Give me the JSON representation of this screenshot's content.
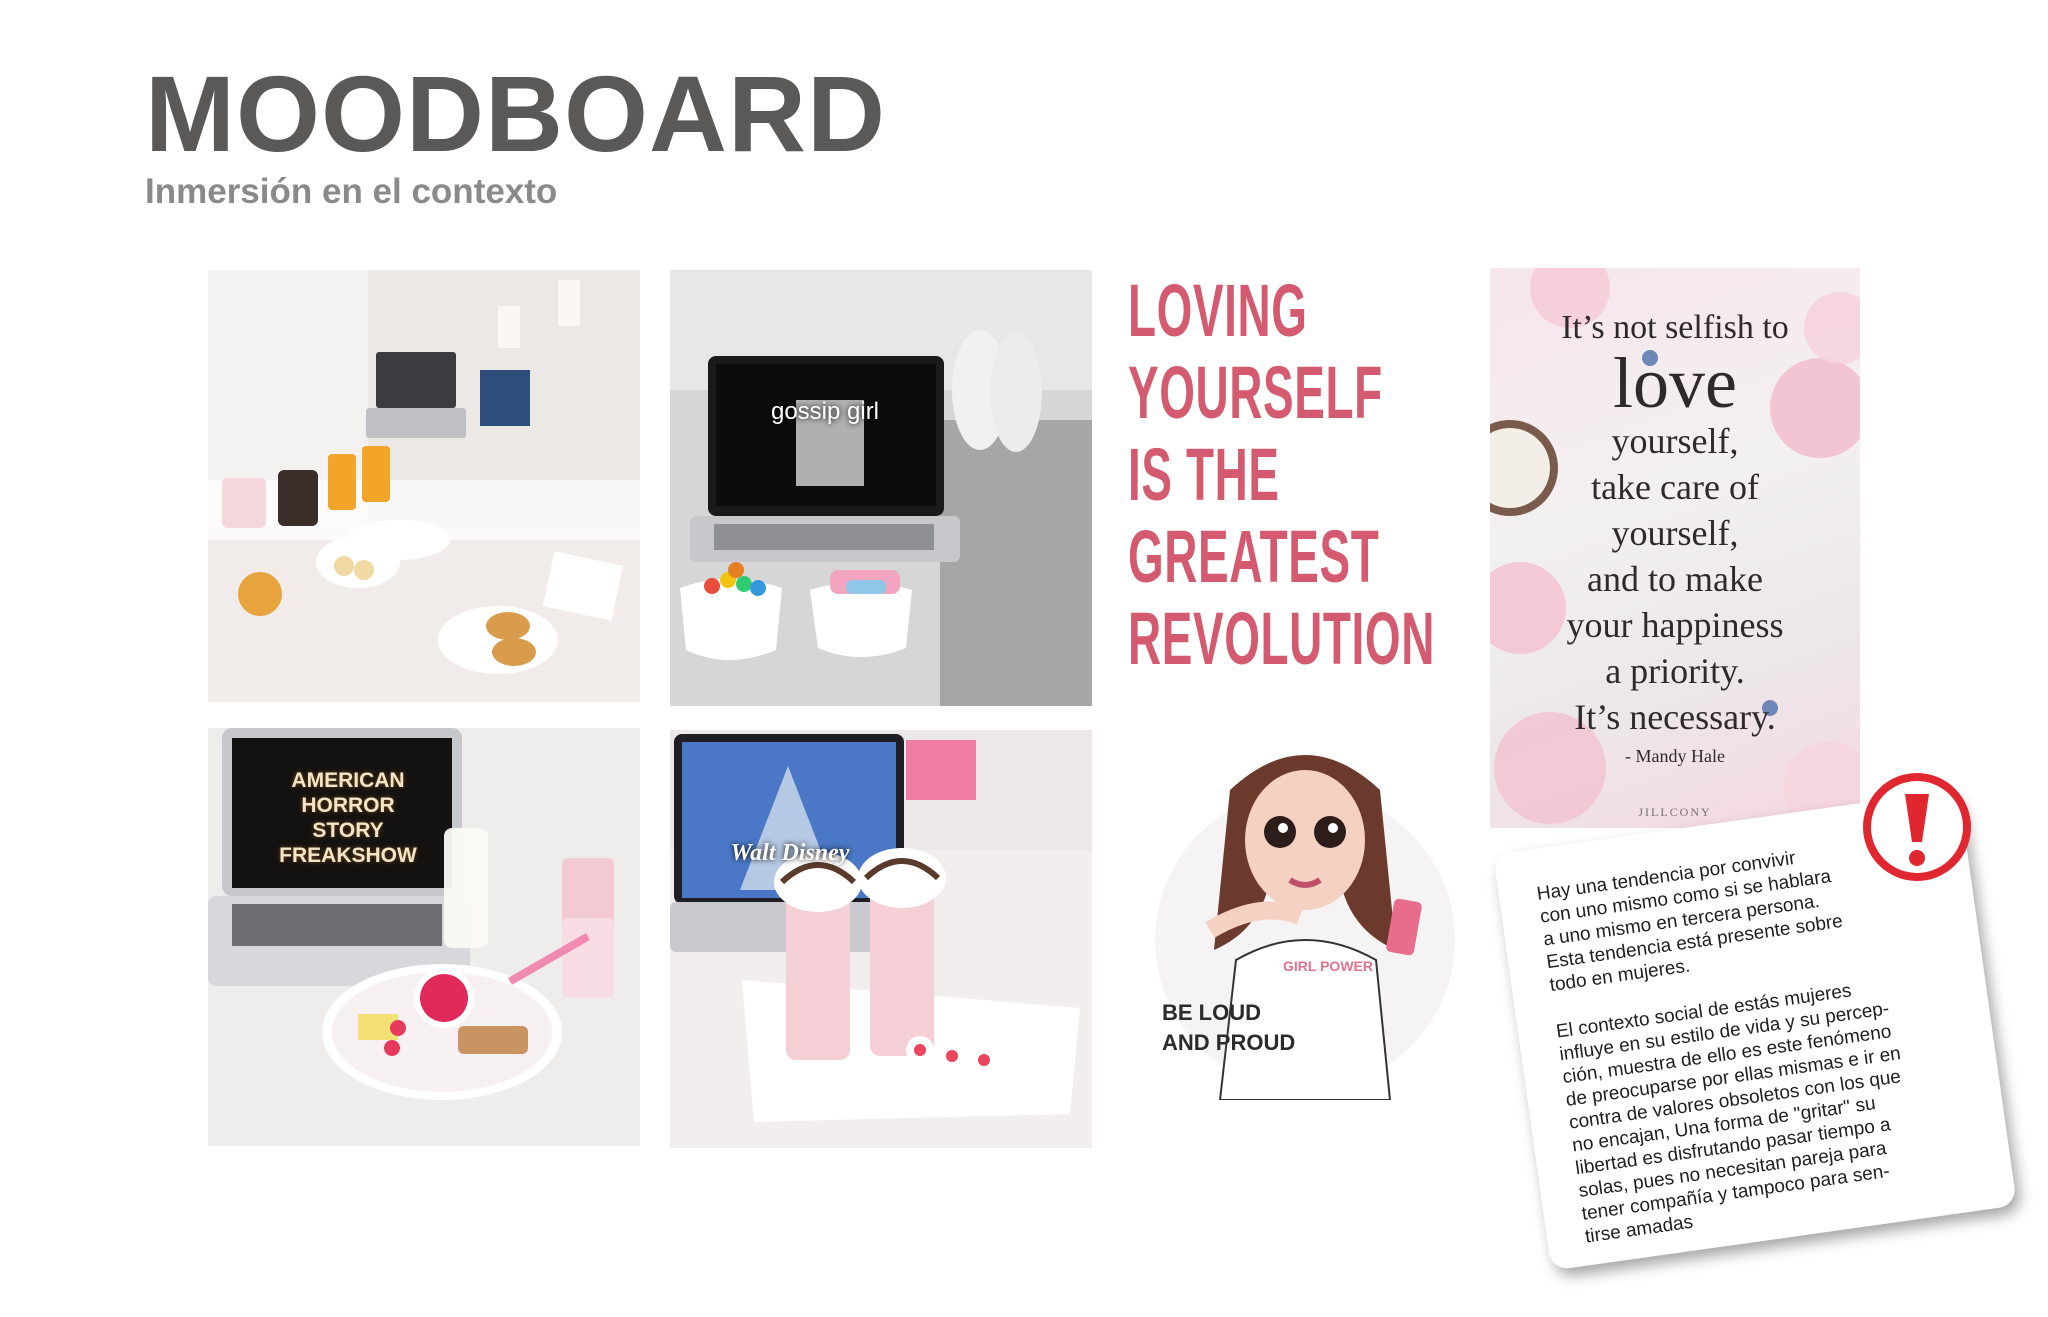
{
  "header": {
    "title": "MOODBOARD",
    "subtitle": "Inmersión en el contexto"
  },
  "photos": [
    {
      "name": "breakfast-in-bed-photo",
      "caption": ""
    },
    {
      "name": "gossip-girl-laptop-photo",
      "caption": "gossip girl"
    },
    {
      "name": "american-horror-story-laptop-photo",
      "caption": "AMERICAN HORROR STORY FREAKSHOW"
    },
    {
      "name": "walt-disney-laptop-photo",
      "caption": "Walt Disney"
    }
  ],
  "poster": {
    "lines": [
      "LOVING",
      "YOURSELF",
      "IS THE",
      "GREATEST",
      "REVOLUTION"
    ],
    "color": "#d45b6f"
  },
  "quote_card": {
    "line1": "It’s not selfish to",
    "line2": "love",
    "lines": [
      "yourself,",
      "take care of",
      "yourself,",
      "and to make",
      "your happiness",
      "a priority.",
      "It’s necessary."
    ],
    "author": "- Mandy Hale",
    "brand": "JILLCONY"
  },
  "illustration": {
    "slogan_line1": "BE LOUD",
    "slogan_line2": "AND PROUD",
    "shirt_text": "GIRL POWER"
  },
  "note": {
    "paragraph1": "Hay una tendencia por convivir\ncon uno mismo como si se hablara\na uno mismo en tercera persona.\nEsta tendencia está presente sobre\ntodo en mujeres.",
    "paragraph2": "El contexto social de estás mujeres\ninfluye en su estilo de vida y su percep-\nción, muestra de ello es este fenómeno\nde preocuparse por ellas mismas e ir en\ncontra de valores obsoletos con los que\nno encajan, Una forma de \"gritar\" su\nlibertad es disfrutando pasar tiempo a\nsolas, pues no necesitan pareja para\ntener compañía y tampoco para sen-\ntirse amadas",
    "alert_icon": "exclamation-icon",
    "alert_color": "#e0262f"
  }
}
